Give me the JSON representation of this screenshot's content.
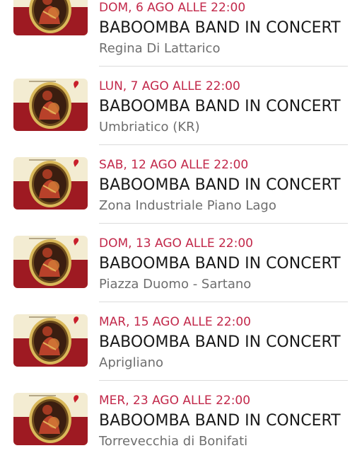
{
  "colors": {
    "date_accent": "#c2284a",
    "title": "#1a1a1a",
    "location": "#6e6e6e",
    "poster_cream": "#f3ecd2",
    "poster_red": "#9e1a22"
  },
  "events": [
    {
      "date": "DOM, 6 AGO ALLE 22:00",
      "title": "BABOOMBA BAND IN CONCERT",
      "location": "Regina Di Lattarico",
      "icon": "concert-poster-thumbnail"
    },
    {
      "date": "LUN, 7 AGO ALLE 22:00",
      "title": "BABOOMBA BAND IN CONCERT",
      "location": "Umbriatico (KR)",
      "icon": "concert-poster-thumbnail"
    },
    {
      "date": "SAB, 12 AGO ALLE 22:00",
      "title": "BABOOMBA BAND IN CONCERT",
      "location": "Zona Industriale Piano Lago",
      "icon": "concert-poster-thumbnail"
    },
    {
      "date": "DOM, 13 AGO ALLE 22:00",
      "title": "BABOOMBA BAND IN CONCERT",
      "location": "Piazza Duomo - Sartano",
      "icon": "concert-poster-thumbnail"
    },
    {
      "date": "MAR, 15 AGO ALLE 22:00",
      "title": "BABOOMBA BAND IN CONCERT",
      "location": "Aprigliano",
      "icon": "concert-poster-thumbnail"
    },
    {
      "date": "MER, 23 AGO ALLE 22:00",
      "title": "BABOOMBA BAND IN CONCERT",
      "location": "Torrevecchia di Bonifati",
      "icon": "concert-poster-thumbnail"
    }
  ]
}
